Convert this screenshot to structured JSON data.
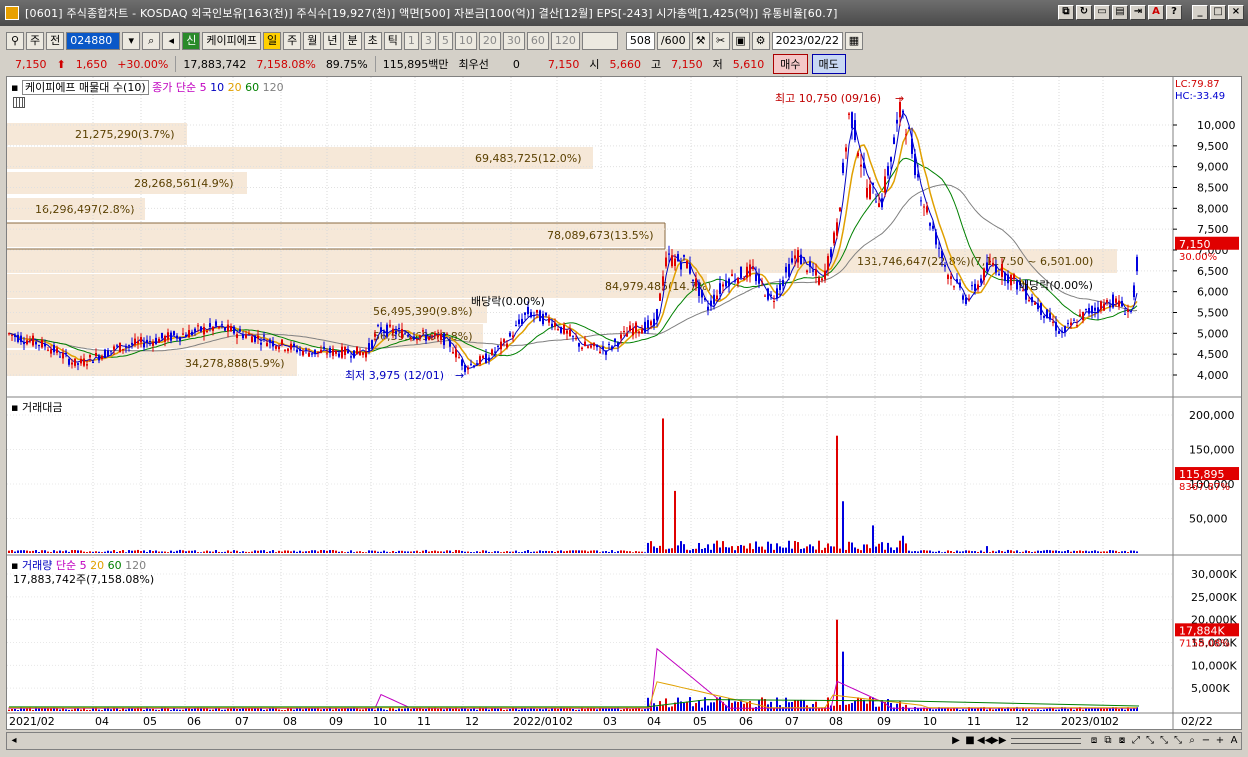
{
  "window": {
    "title": "[0601] 주식종합차트 - KOSDAQ 외국인보유[163(천)] 주식수[19,927(천)] 액면[500] 자본금[100(억)] 결산[12월] EPS[-243] 시가총액[1,425(억)] 유통비율[60.7]"
  },
  "toolbar": {
    "market": "주",
    "prev": "전",
    "code": "024880",
    "new_badge": "신",
    "stock_name": "케이피에프",
    "periods": [
      "일",
      "주",
      "월",
      "년",
      "분",
      "초",
      "틱"
    ],
    "minutes": [
      "1",
      "3",
      "5",
      "10",
      "20",
      "30",
      "60",
      "120"
    ],
    "count": "508",
    "count_total": "/600",
    "date": "2023/02/22"
  },
  "quote": {
    "price": "7,150",
    "change": "1,650",
    "change_pct": "+30.00%",
    "volume": "17,883,742",
    "volume_ratio": "7,158.08%",
    "turnover": "89.75%",
    "amount": "115,895백만",
    "best_label": "최우선",
    "best_value": "0",
    "best_price": "7,150",
    "open_label": "시",
    "open": "5,660",
    "high_label": "고",
    "high": "7,150",
    "low_label": "저",
    "low": "5,610",
    "buy": "매수",
    "sell": "매도"
  },
  "price_panel": {
    "name": "케이피에프 매물대 수(10)",
    "ma_label": "종가 단순",
    "ma": [
      "5",
      "10",
      "20",
      "60",
      "120"
    ],
    "lc": "LC:79.87",
    "hc": "HC:-33.49",
    "current": "7,150",
    "current_pct": "30.00%",
    "high_note": "최고 10,750 (09/16)",
    "low_note": "최저 3,975 (12/01)",
    "dividend1": "배당락(0.00%)",
    "dividend2": "배당락(0.00%)",
    "vol_profile": [
      "21,275,290(3.7%)",
      "69,483,725(12.0%)",
      "28,268,561(4.9%)",
      "16,296,497(2.8%)",
      "78,089,673(13.5%)",
      "131,746,647(22.8%)(7,117.50 ~ 6,501.00)",
      "84,979,485(14.7%)",
      "56,495,390(9.8%)",
      "56,593,690(9.8%)",
      "34,278,888(5.9%)"
    ],
    "y_ticks": [
      "10,000",
      "9,500",
      "9,000",
      "8,500",
      "8,000",
      "7,500",
      "7,000",
      "6,500",
      "6,000",
      "5,500",
      "5,000",
      "4,500",
      "4,000"
    ]
  },
  "amount_panel": {
    "name": "거래대금",
    "current": "115,895",
    "current_pct": "8367.87%",
    "y_ticks": [
      "200,000",
      "150,000",
      "100,000",
      "50,000"
    ]
  },
  "volume_panel": {
    "name": "거래량",
    "ma_label": "단순",
    "ma": [
      "5",
      "20",
      "60",
      "120"
    ],
    "info": "17,883,742주(7,158.08%)",
    "current": "17,884K",
    "current_pct": "7158.08%",
    "y_ticks": [
      "30,000K",
      "25,000K",
      "20,000K",
      "15,000K",
      "10,000K",
      "5,000K"
    ]
  },
  "x_axis": [
    "2021/02",
    "04",
    "05",
    "06",
    "07",
    "08",
    "09",
    "10",
    "11",
    "12",
    "2022/01",
    "02",
    "03",
    "04",
    "05",
    "06",
    "07",
    "08",
    "09",
    "10",
    "11",
    "12",
    "2023/01",
    "02",
    "02/22"
  ],
  "colors": {
    "up": "#e00000",
    "down": "#0000e0",
    "ma5": "#c000c0",
    "ma10": "#0000c0",
    "ma20": "#e0a000",
    "ma60": "#008000",
    "ma120": "#808080",
    "profile": "#f6e8d8"
  }
}
